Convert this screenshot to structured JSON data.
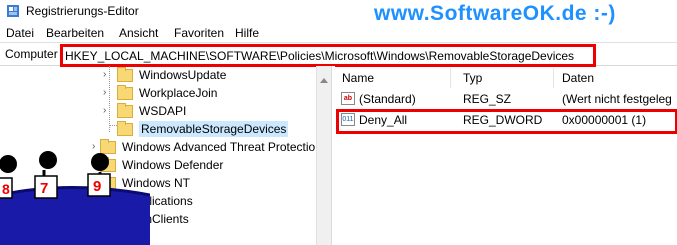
{
  "window": {
    "title": "Registrierungs-Editor"
  },
  "watermark": "www.SoftwareOK.de :-)",
  "menu": [
    "Datei",
    "Bearbeiten",
    "Ansicht",
    "Favoriten",
    "Hilfe"
  ],
  "address": {
    "label": "Computer",
    "path": "HKEY_LOCAL_MACHINE\\SOFTWARE\\Policies\\Microsoft\\Windows\\RemovableStorageDevices"
  },
  "tree": {
    "items": [
      {
        "label": "WindowsUpdate"
      },
      {
        "label": "WorkplaceJoin"
      },
      {
        "label": "WSDAPI"
      },
      {
        "label": "RemovableStorageDevices",
        "selected": true
      },
      {
        "label": "Windows Advanced Threat Protectio"
      },
      {
        "label": "Windows Defender"
      },
      {
        "label": "Windows NT"
      },
      {
        "label": "pplications"
      },
      {
        "label": "ionClients"
      }
    ]
  },
  "columns": {
    "name": "Name",
    "type": "Typ",
    "data": "Daten"
  },
  "values": [
    {
      "name": "(Standard)",
      "type": "REG_SZ",
      "data": "(Wert nicht festgeleg",
      "icon": "ab"
    },
    {
      "name": "Deny_All",
      "type": "REG_DWORD",
      "data": "0x00000001 (1)",
      "icon": "011"
    }
  ],
  "cartoon": {
    "numbers": [
      "8",
      "7",
      "9"
    ]
  },
  "colors": {
    "accent_red": "#e00000",
    "watermark": "#1e90ff",
    "selection": "#cce8ff"
  }
}
